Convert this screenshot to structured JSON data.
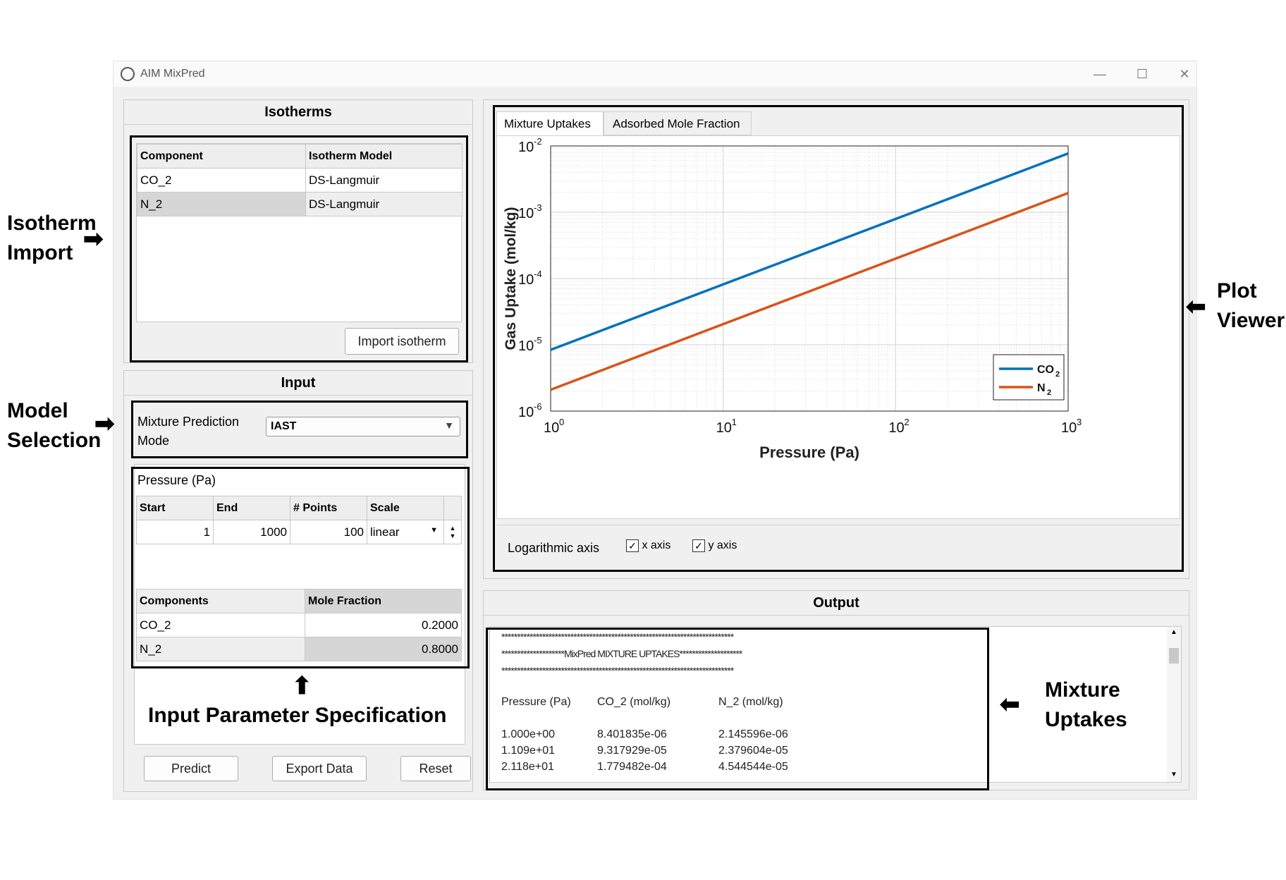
{
  "window": {
    "title": "AIM MixPred",
    "minimize": "—",
    "maximize": "☐",
    "close": "✕"
  },
  "isotherms": {
    "title": "Isotherms",
    "headers": [
      "Component",
      "Isotherm Model"
    ],
    "rows": [
      [
        "CO_2",
        "DS-Langmuir"
      ],
      [
        "N_2",
        "DS-Langmuir"
      ]
    ],
    "import_button": "Import isotherm"
  },
  "input": {
    "title": "Input",
    "mode_label": "Mixture Prediction Mode",
    "mode_value": "IAST",
    "pressure_title": "Pressure (Pa)",
    "pressure_headers": [
      "Start",
      "End",
      "# Points",
      "Scale"
    ],
    "pressure_values": [
      "1",
      "1000",
      "100",
      "linear"
    ],
    "fraction_headers": [
      "Components",
      "Mole Fraction"
    ],
    "fraction_rows": [
      [
        "CO_2",
        "0.2000"
      ],
      [
        "N_2",
        "0.8000"
      ]
    ],
    "buttons": {
      "predict": "Predict",
      "export": "Export Data",
      "reset": "Reset"
    }
  },
  "plot": {
    "tabs": [
      "Mixture Uptakes",
      "Adsorbed Mole Fraction"
    ],
    "log_axis_label": "Logarithmic axis",
    "x_axis_check": "x axis",
    "y_axis_check": "y axis"
  },
  "chart_data": {
    "type": "line",
    "xlabel": "Pressure (Pa)",
    "ylabel": "Gas Uptake (mol/kg)",
    "xscale": "log",
    "yscale": "log",
    "xlim": [
      1,
      1000
    ],
    "ylim": [
      1e-06,
      0.01
    ],
    "xticks": [
      {
        "base": "10",
        "exp": "0",
        "value": 1
      },
      {
        "base": "10",
        "exp": "1",
        "value": 10
      },
      {
        "base": "10",
        "exp": "2",
        "value": 100
      },
      {
        "base": "10",
        "exp": "3",
        "value": 1000
      }
    ],
    "yticks": [
      {
        "base": "10",
        "exp": "-2",
        "value": 0.01
      },
      {
        "base": "10",
        "exp": "-3",
        "value": 0.001
      },
      {
        "base": "10",
        "exp": "-4",
        "value": 0.0001
      },
      {
        "base": "10",
        "exp": "-5",
        "value": 1e-05
      },
      {
        "base": "10",
        "exp": "-6",
        "value": 1e-06
      }
    ],
    "grid": true,
    "legend_position": "bottom-right",
    "series": [
      {
        "name": "CO",
        "sub": "2",
        "color": "#0072bd",
        "x": [
          1,
          1000
        ],
        "y": [
          8.4e-06,
          0.0077
        ]
      },
      {
        "name": "N",
        "sub": "2",
        "color": "#d95319",
        "x": [
          1,
          1000
        ],
        "y": [
          2.1e-06,
          0.00195
        ]
      }
    ]
  },
  "output": {
    "title": "Output",
    "lines": [
      "**************************************************************************",
      "********************MixPred MIXTURE UPTAKES********************",
      "**************************************************************************"
    ],
    "headers": [
      "Pressure (Pa)",
      "CO_2 (mol/kg)",
      "N_2 (mol/kg)"
    ],
    "rows": [
      [
        "1.000e+00",
        "8.401835e-06",
        "2.145596e-06"
      ],
      [
        "1.109e+01",
        "9.317929e-05",
        "2.379604e-05"
      ],
      [
        "2.118e+01",
        "1.779482e-04",
        "4.544544e-05"
      ]
    ]
  },
  "annotations": {
    "isotherm_import": [
      "Isotherm",
      "Import"
    ],
    "model_selection": [
      "Model",
      "Selection"
    ],
    "input_param": "Input Parameter Specification",
    "plot_viewer": [
      "Plot",
      "Viewer"
    ],
    "mixture_uptakes": [
      "Mixture",
      "Uptakes"
    ],
    "arrow_right": "➡",
    "arrow_left": "⬅",
    "arrow_up": "⬆"
  }
}
